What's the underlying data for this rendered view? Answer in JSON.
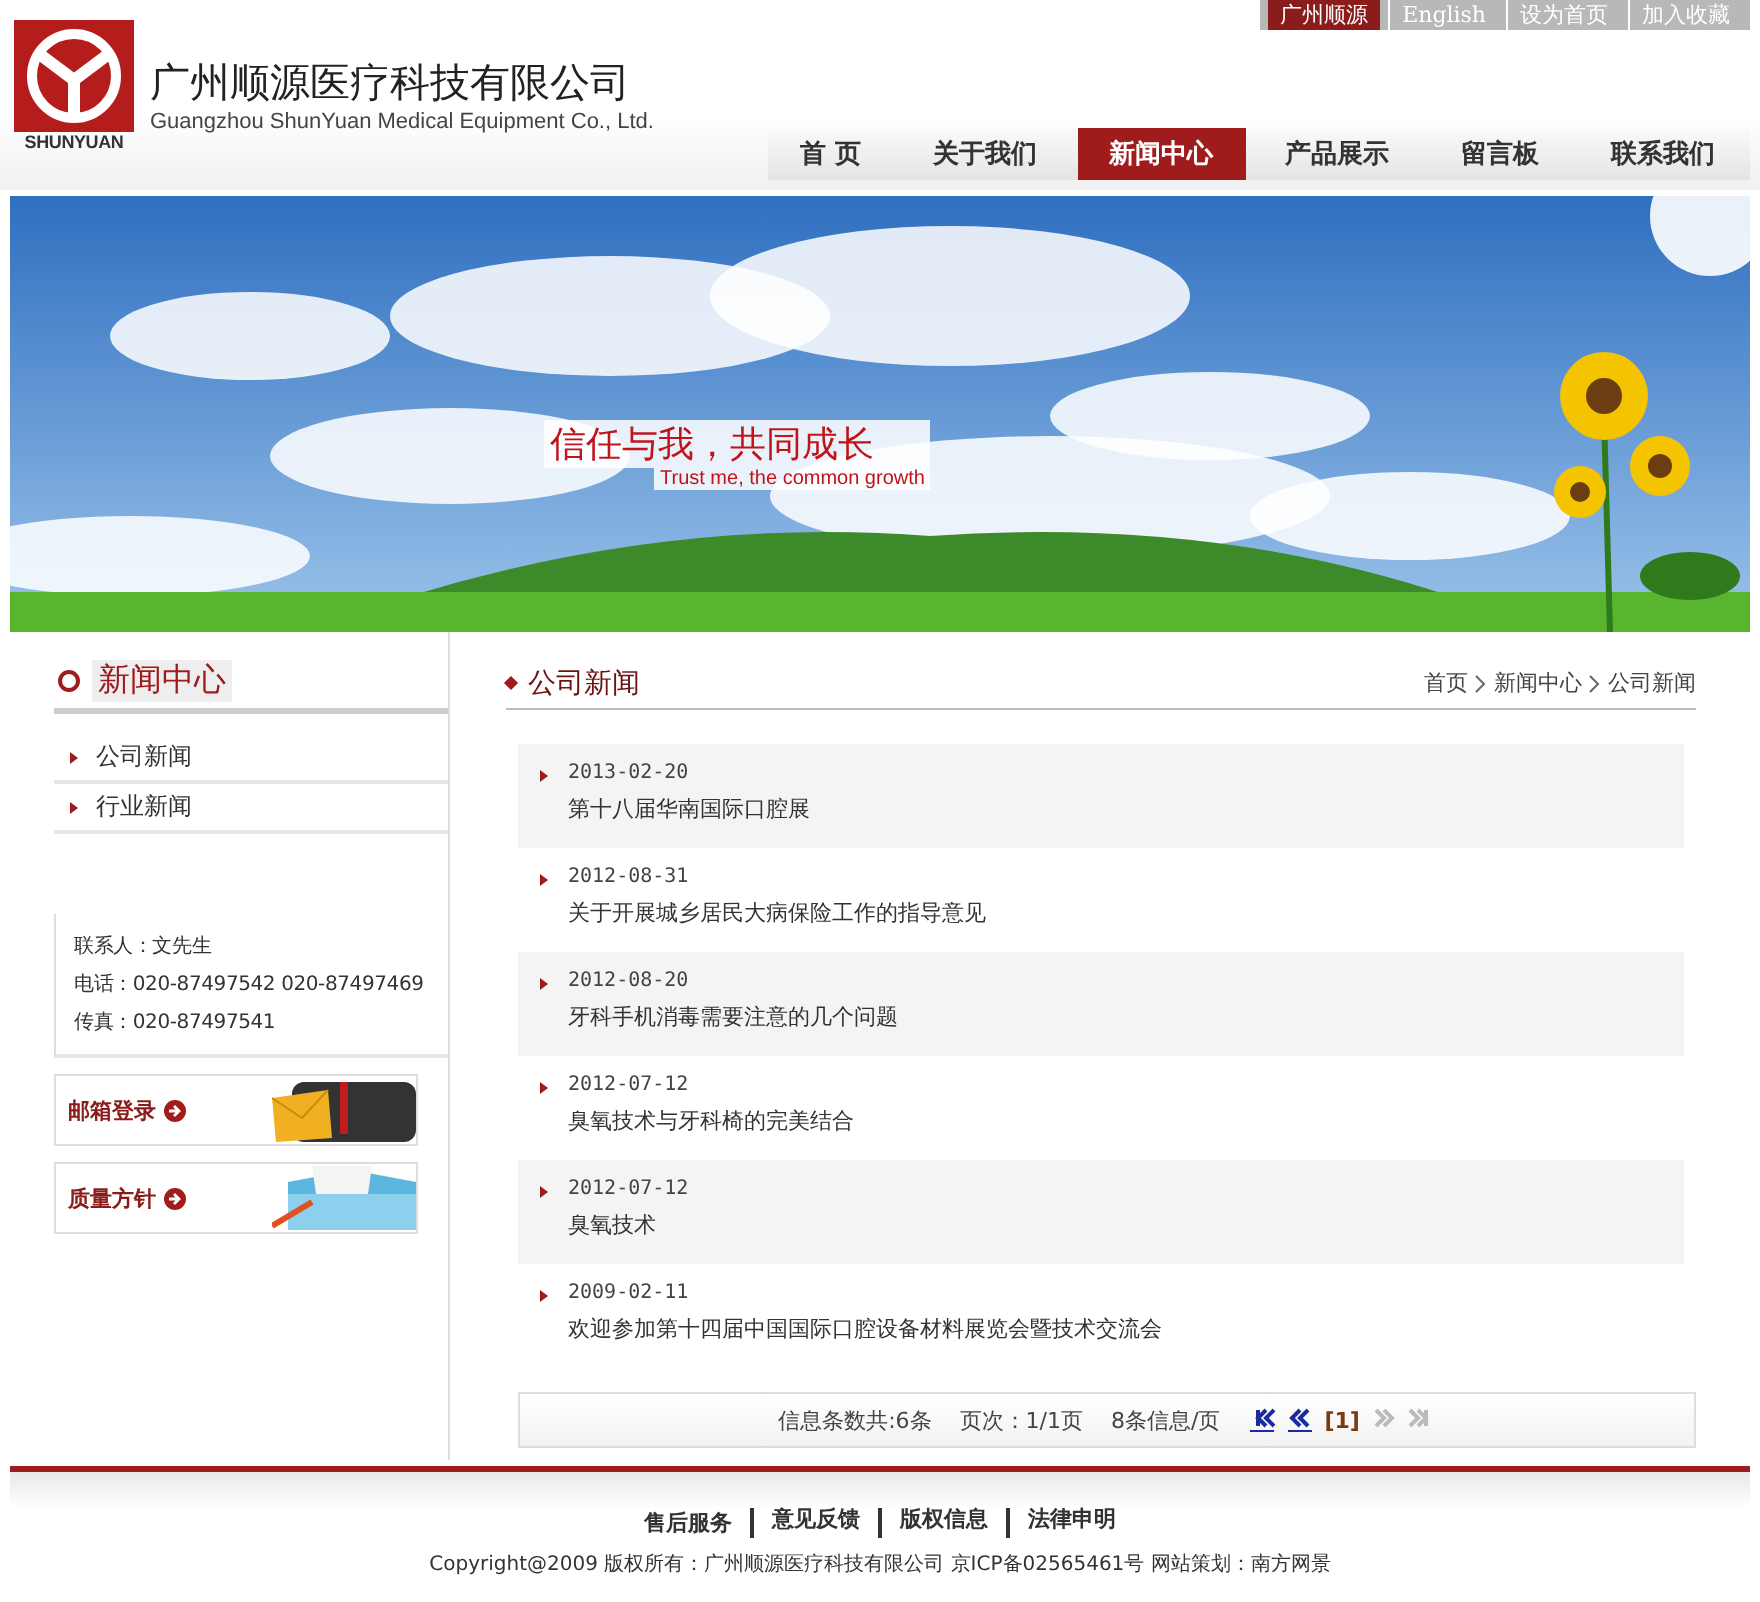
{
  "top_links": [
    {
      "label": "广州顺源",
      "selected": true
    },
    {
      "label": "English",
      "selected": false
    },
    {
      "label": "设为首页",
      "selected": false
    },
    {
      "label": "加入收藏",
      "selected": false
    }
  ],
  "logo": {
    "text": "SHUNYUAN"
  },
  "company": {
    "name": "广州顺源医疗科技有限公司",
    "name_en": "Guangzhou ShunYuan Medical Equipment Co., Ltd."
  },
  "nav": [
    {
      "label": "首 页",
      "selected": false
    },
    {
      "label": "关于我们",
      "selected": false
    },
    {
      "label": "新闻中心",
      "selected": true
    },
    {
      "label": "产品展示",
      "selected": false
    },
    {
      "label": "留言板",
      "selected": false
    },
    {
      "label": "联系我们",
      "selected": false
    }
  ],
  "banner": {
    "slogan": "信任与我，共同成长",
    "slogan_en": "Trust me, the common growth"
  },
  "sidebar": {
    "title": "新闻中心",
    "items": [
      {
        "label": "公司新闻"
      },
      {
        "label": "行业新闻"
      }
    ],
    "contact": [
      "联系人：文先生",
      "电话：020-87497542 020-87497469",
      "传真：020-87497541"
    ],
    "promos": [
      {
        "kind": "mail",
        "label": "邮箱登录"
      },
      {
        "kind": "quality",
        "label": "质量方针"
      }
    ]
  },
  "content": {
    "title": "公司新闻",
    "breadcrumb": [
      "首页",
      "新闻中心",
      "公司新闻"
    ],
    "news": [
      {
        "date": "2013-02-20",
        "title": "第十八届华南国际口腔展"
      },
      {
        "date": "2012-08-31",
        "title": "关于开展城乡居民大病保险工作的指导意见"
      },
      {
        "date": "2012-08-20",
        "title": "牙科手机消毒需要注意的几个问题"
      },
      {
        "date": "2012-07-12",
        "title": "臭氧技术与牙科椅的完美结合"
      },
      {
        "date": "2012-07-12",
        "title": "臭氧技术"
      },
      {
        "date": "2009-02-11",
        "title": "欢迎参加第十四届中国国际口腔设备材料展览会暨技术交流会"
      }
    ],
    "pager": {
      "total": "信息条数共:6条",
      "pages": "页次：1/1页",
      "per_page": "8条信息/页",
      "current": "[1]",
      "buttons": [
        {
          "kind": "first",
          "disabled": false
        },
        {
          "kind": "prev",
          "disabled": false
        },
        {
          "kind": "next",
          "disabled": true
        },
        {
          "kind": "last",
          "disabled": true
        }
      ]
    }
  },
  "footer": {
    "links": [
      "售后服务",
      "意见反馈",
      "版权信息",
      "法律申明"
    ],
    "copyright": "Copyright@2009 版权所有：广州顺源医疗科技有限公司 京ICP备02565461号 网站策划：南方网景"
  }
}
